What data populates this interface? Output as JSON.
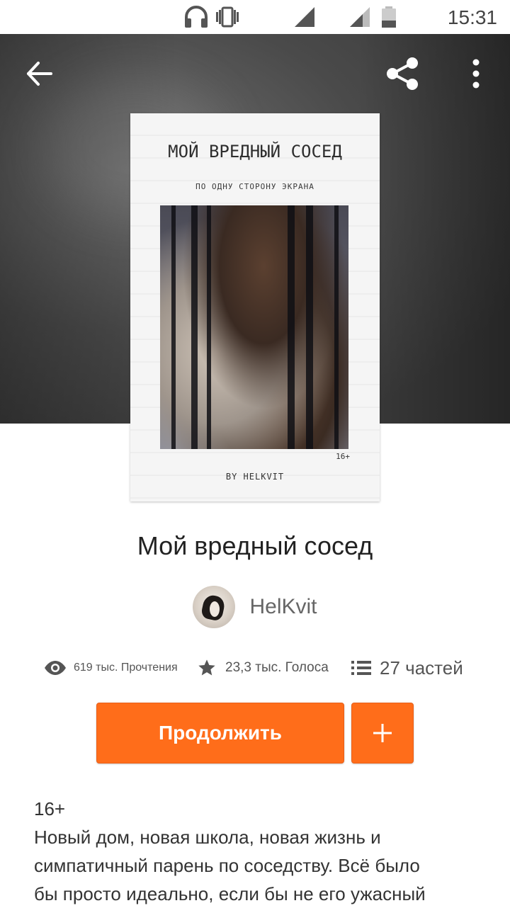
{
  "status_bar": {
    "time": "15:31",
    "icons": [
      "headset-icon",
      "vibrate-icon",
      "signal-icon",
      "signal-icon",
      "battery-icon"
    ]
  },
  "toolbar": {
    "back_icon": "arrow-left-icon",
    "share_icon": "share-icon",
    "more_icon": "more-vertical-icon"
  },
  "cover": {
    "title": "МОЙ ВРЕДНЫЙ СОСЕД",
    "subtitle": "ПО ОДНУ СТОРОНУ ЭКРАНА",
    "age": "16+",
    "author": "BY HELKVIT"
  },
  "story": {
    "title": "Мой вредный сосед",
    "author": "HelKvit"
  },
  "stats": {
    "reads": "619 тыс. Прочтения",
    "votes": "23,3 тыс. Голоса",
    "parts": "27 частей"
  },
  "actions": {
    "continue_label": "Продолжить",
    "add_icon": "plus-icon"
  },
  "description": {
    "age": "16+",
    "lines": [
      "Новый дом, новая школа, новая жизнь и",
      "симпатичный парень по соседству. Всё было",
      "бы просто идеально, если бы не его ужасный"
    ]
  },
  "colors": {
    "accent": "#ff6d1a",
    "hero_bg": "#3f3f3f"
  }
}
